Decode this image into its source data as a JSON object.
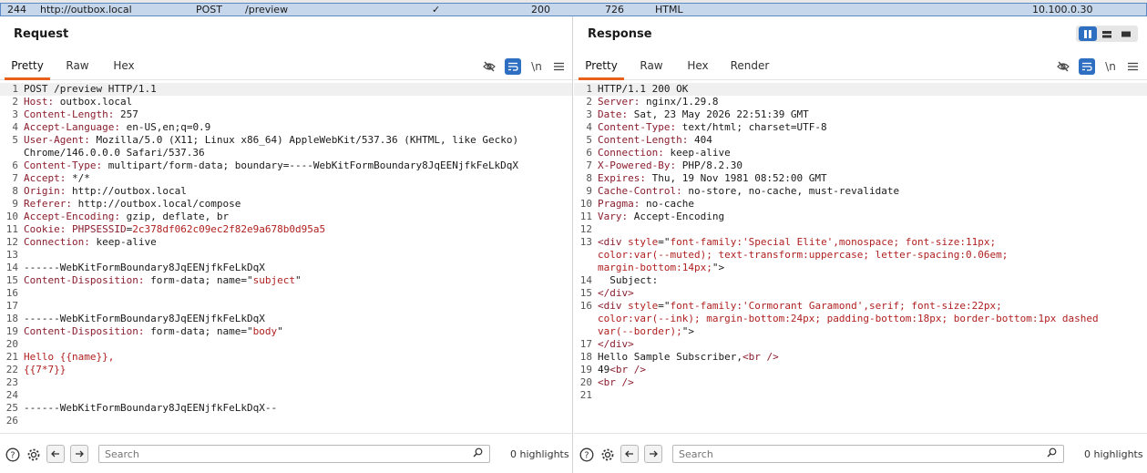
{
  "history": {
    "id": "244",
    "host": "http://outbox.local",
    "method": "POST",
    "path": "/preview",
    "check": "✓",
    "status": "200",
    "length": "726",
    "mime": "HTML",
    "ip": "10.100.0.30"
  },
  "request": {
    "title": "Request",
    "tabs": [
      "Pretty",
      "Raw",
      "Hex"
    ],
    "newline_label": "\\n",
    "lines": [
      {
        "n": "1",
        "parts": [
          {
            "c": "b",
            "t": "POST /preview HTTP/1.1"
          }
        ]
      },
      {
        "n": "2",
        "parts": [
          {
            "c": "k",
            "t": "Host:"
          },
          {
            "c": "v",
            "t": " outbox.local"
          }
        ]
      },
      {
        "n": "3",
        "parts": [
          {
            "c": "k",
            "t": "Content-Length:"
          },
          {
            "c": "v",
            "t": " 257"
          }
        ]
      },
      {
        "n": "4",
        "parts": [
          {
            "c": "k",
            "t": "Accept-Language:"
          },
          {
            "c": "v",
            "t": " en-US,en;q=0.9"
          }
        ]
      },
      {
        "n": "5",
        "parts": [
          {
            "c": "k",
            "t": "User-Agent:"
          },
          {
            "c": "v",
            "t": " Mozilla/5.0 (X11; Linux x86_64) AppleWebKit/537.36 (KHTML, like Gecko)"
          }
        ]
      },
      {
        "n": "",
        "parts": [
          {
            "c": "v",
            "t": "Chrome/146.0.0.0 Safari/537.36"
          }
        ]
      },
      {
        "n": "6",
        "parts": [
          {
            "c": "k",
            "t": "Content-Type:"
          },
          {
            "c": "v",
            "t": " multipart/form-data; boundary=----WebKitFormBoundary8JqEENjfkFeLkDqX"
          }
        ]
      },
      {
        "n": "7",
        "parts": [
          {
            "c": "k",
            "t": "Accept:"
          },
          {
            "c": "v",
            "t": " */*"
          }
        ]
      },
      {
        "n": "8",
        "parts": [
          {
            "c": "k",
            "t": "Origin:"
          },
          {
            "c": "v",
            "t": " http://outbox.local"
          }
        ]
      },
      {
        "n": "9",
        "parts": [
          {
            "c": "k",
            "t": "Referer:"
          },
          {
            "c": "v",
            "t": " http://outbox.local/compose"
          }
        ]
      },
      {
        "n": "10",
        "parts": [
          {
            "c": "k",
            "t": "Accept-Encoding:"
          },
          {
            "c": "v",
            "t": " gzip, deflate, br"
          }
        ]
      },
      {
        "n": "11",
        "parts": [
          {
            "c": "k",
            "t": "Cookie:"
          },
          {
            "c": "v",
            "t": " "
          },
          {
            "c": "k",
            "t": "PHPSESSID"
          },
          {
            "c": "v",
            "t": "="
          },
          {
            "c": "r",
            "t": "2c378df062c09ec2f82e9a678b0d95a5"
          }
        ]
      },
      {
        "n": "12",
        "parts": [
          {
            "c": "k",
            "t": "Connection:"
          },
          {
            "c": "v",
            "t": " keep-alive"
          }
        ]
      },
      {
        "n": "13",
        "parts": []
      },
      {
        "n": "14",
        "parts": [
          {
            "c": "b",
            "t": "------WebKitFormBoundary8JqEENjfkFeLkDqX"
          }
        ]
      },
      {
        "n": "15",
        "parts": [
          {
            "c": "k",
            "t": "Content-Disposition:"
          },
          {
            "c": "v",
            "t": " form-data; name=\""
          },
          {
            "c": "r",
            "t": "subject"
          },
          {
            "c": "v",
            "t": "\""
          }
        ]
      },
      {
        "n": "16",
        "parts": []
      },
      {
        "n": "17",
        "parts": []
      },
      {
        "n": "18",
        "parts": [
          {
            "c": "b",
            "t": "------WebKitFormBoundary8JqEENjfkFeLkDqX"
          }
        ]
      },
      {
        "n": "19",
        "parts": [
          {
            "c": "k",
            "t": "Content-Disposition:"
          },
          {
            "c": "v",
            "t": " form-data; name=\""
          },
          {
            "c": "r",
            "t": "body"
          },
          {
            "c": "v",
            "t": "\""
          }
        ]
      },
      {
        "n": "20",
        "parts": []
      },
      {
        "n": "21",
        "parts": [
          {
            "c": "r",
            "t": "Hello {{name}},"
          }
        ]
      },
      {
        "n": "22",
        "parts": [
          {
            "c": "r",
            "t": "{{7*7}}"
          }
        ]
      },
      {
        "n": "23",
        "parts": []
      },
      {
        "n": "24",
        "parts": []
      },
      {
        "n": "25",
        "parts": [
          {
            "c": "b",
            "t": "------WebKitFormBoundary8JqEENjfkFeLkDqX--"
          }
        ]
      },
      {
        "n": "26",
        "parts": []
      }
    ],
    "search_placeholder": "Search",
    "highlights": "0 highlights"
  },
  "response": {
    "title": "Response",
    "tabs": [
      "Pretty",
      "Raw",
      "Hex",
      "Render"
    ],
    "newline_label": "\\n",
    "lines": [
      {
        "n": "1",
        "parts": [
          {
            "c": "b",
            "t": "HTTP/1.1 200 OK"
          }
        ]
      },
      {
        "n": "2",
        "parts": [
          {
            "c": "k",
            "t": "Server:"
          },
          {
            "c": "v",
            "t": " nginx/1.29.8"
          }
        ]
      },
      {
        "n": "3",
        "parts": [
          {
            "c": "k",
            "t": "Date:"
          },
          {
            "c": "v",
            "t": " Sat, 23 May 2026 22:51:39 GMT"
          }
        ]
      },
      {
        "n": "4",
        "parts": [
          {
            "c": "k",
            "t": "Content-Type:"
          },
          {
            "c": "v",
            "t": " text/html; charset=UTF-8"
          }
        ]
      },
      {
        "n": "5",
        "parts": [
          {
            "c": "k",
            "t": "Content-Length:"
          },
          {
            "c": "v",
            "t": " 404"
          }
        ]
      },
      {
        "n": "6",
        "parts": [
          {
            "c": "k",
            "t": "Connection:"
          },
          {
            "c": "v",
            "t": " keep-alive"
          }
        ]
      },
      {
        "n": "7",
        "parts": [
          {
            "c": "k",
            "t": "X-Powered-By:"
          },
          {
            "c": "v",
            "t": " PHP/8.2.30"
          }
        ]
      },
      {
        "n": "8",
        "parts": [
          {
            "c": "k",
            "t": "Expires:"
          },
          {
            "c": "v",
            "t": " Thu, 19 Nov 1981 08:52:00 GMT"
          }
        ]
      },
      {
        "n": "9",
        "parts": [
          {
            "c": "k",
            "t": "Cache-Control:"
          },
          {
            "c": "v",
            "t": " no-store, no-cache, must-revalidate"
          }
        ]
      },
      {
        "n": "10",
        "parts": [
          {
            "c": "k",
            "t": "Pragma:"
          },
          {
            "c": "v",
            "t": " no-cache"
          }
        ]
      },
      {
        "n": "11",
        "parts": [
          {
            "c": "k",
            "t": "Vary:"
          },
          {
            "c": "v",
            "t": " Accept-Encoding"
          }
        ]
      },
      {
        "n": "12",
        "parts": []
      },
      {
        "n": "13",
        "parts": [
          {
            "c": "t",
            "t": "<div"
          },
          {
            "c": "v",
            "t": " "
          },
          {
            "c": "r",
            "t": "style"
          },
          {
            "c": "v",
            "t": "=\""
          },
          {
            "c": "r",
            "t": "font-family:'Special Elite',monospace; font-size:11px;"
          }
        ]
      },
      {
        "n": "",
        "parts": [
          {
            "c": "r",
            "t": "color:var(--muted); text-transform:uppercase; letter-spacing:0.06em;"
          }
        ]
      },
      {
        "n": "",
        "parts": [
          {
            "c": "r",
            "t": "margin-bottom:14px;"
          },
          {
            "c": "v",
            "t": "\">"
          }
        ]
      },
      {
        "n": "14",
        "parts": [
          {
            "c": "v",
            "t": "  Subject:"
          }
        ]
      },
      {
        "n": "15",
        "parts": [
          {
            "c": "t",
            "t": "</div>"
          }
        ]
      },
      {
        "n": "16",
        "parts": [
          {
            "c": "t",
            "t": "<div"
          },
          {
            "c": "v",
            "t": " "
          },
          {
            "c": "r",
            "t": "style"
          },
          {
            "c": "v",
            "t": "=\""
          },
          {
            "c": "r",
            "t": "font-family:'Cormorant Garamond',serif; font-size:22px;"
          }
        ]
      },
      {
        "n": "",
        "parts": [
          {
            "c": "r",
            "t": "color:var(--ink); margin-bottom:24px; padding-bottom:18px; border-bottom:1px dashed"
          }
        ]
      },
      {
        "n": "",
        "parts": [
          {
            "c": "r",
            "t": "var(--border);"
          },
          {
            "c": "v",
            "t": "\">"
          }
        ]
      },
      {
        "n": "17",
        "parts": [
          {
            "c": "t",
            "t": "</div>"
          }
        ]
      },
      {
        "n": "18",
        "parts": [
          {
            "c": "v",
            "t": "Hello Sample Subscriber,"
          },
          {
            "c": "t",
            "t": "<br />"
          }
        ]
      },
      {
        "n": "19",
        "parts": [
          {
            "c": "v",
            "t": "49"
          },
          {
            "c": "t",
            "t": "<br />"
          }
        ]
      },
      {
        "n": "20",
        "parts": [
          {
            "c": "t",
            "t": "<br />"
          }
        ]
      },
      {
        "n": "21",
        "parts": []
      }
    ],
    "search_placeholder": "Search",
    "highlights": "0 highlights"
  },
  "colors": {
    "accent": "#e8601c",
    "toggle_blue": "#2f6fc2",
    "history_bg": "#c6d7ec",
    "header_name": "#8a1d2d",
    "value_red": "#b02020"
  },
  "icons": {
    "hide": "eye-slash-icon",
    "wrap": "word-wrap-icon",
    "menu": "hamburger-menu-icon",
    "help": "help-circle-icon",
    "settings": "gear-icon",
    "back": "arrow-left-icon",
    "forward": "arrow-right-icon",
    "search": "magnifier-icon"
  }
}
